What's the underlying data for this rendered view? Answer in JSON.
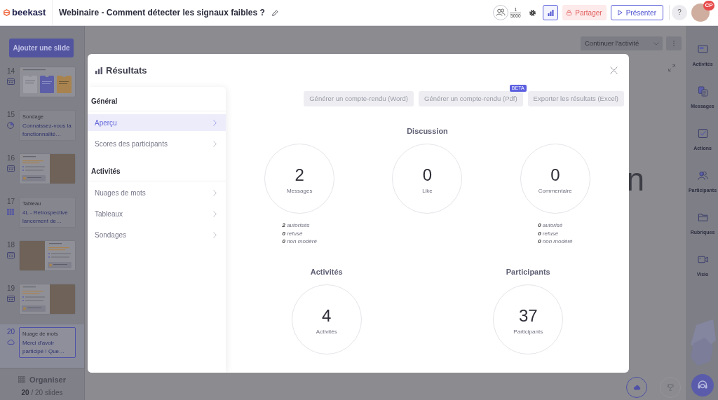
{
  "top_bar": {
    "logo": "beekast",
    "title": "Webinaire - Comment détecter les signaux faibles ?",
    "participants_current": "1",
    "participants_max": "5000",
    "results_button": {
      "selected": true
    },
    "share_button": "Partager",
    "present_button": "Présenter",
    "help_button": "?",
    "avatar_badge": "CP"
  },
  "slides_panel": {
    "add_button": "Ajouter une slide",
    "slides": [
      {
        "number": "14",
        "kind": "cards",
        "selected": false
      },
      {
        "number": "15",
        "kind": "poll",
        "type_label": "Sondage",
        "title": "Connaissez-vous la fonctionnalité…",
        "selected": false
      },
      {
        "number": "16",
        "kind": "text_photo",
        "selected": false
      },
      {
        "number": "17",
        "kind": "table",
        "type_label": "Tableau",
        "title": "4L - Retrospective lancement de…",
        "selected": false
      },
      {
        "number": "18",
        "kind": "photo_text",
        "selected": false
      },
      {
        "number": "19",
        "kind": "text_photo",
        "selected": false
      },
      {
        "number": "20",
        "kind": "word_cloud",
        "type_label": "Nuage de mots",
        "title": "Merci d'avoir participé ! Que…",
        "selected": true
      }
    ],
    "organize_button": "Organiser",
    "slide_count": "**20** / 20 slides"
  },
  "stage": {
    "continue_button": "Continuer l'activité",
    "slide_text": "n"
  },
  "right_sidebar": [
    {
      "kind": "activities",
      "label": "Activités"
    },
    {
      "kind": "messages",
      "label": "Messages"
    },
    {
      "kind": "actions",
      "label": "Actions"
    },
    {
      "kind": "participants",
      "label": "Participants"
    },
    {
      "kind": "rubrics",
      "label": "Rubriques"
    },
    {
      "kind": "video",
      "label": "Visio"
    }
  ],
  "results_modal": {
    "title": "Résultats",
    "nav": [
      {
        "heading": "Général",
        "items": [
          {
            "label": "Aperçu",
            "selected": true
          },
          {
            "label": "Scores des participants",
            "selected": false
          }
        ]
      },
      {
        "heading": "Activités",
        "items": [
          {
            "label": "Nuages de mots",
            "selected": false
          },
          {
            "label": "Tableaux",
            "selected": false
          },
          {
            "label": "Sondages",
            "selected": false
          }
        ]
      }
    ],
    "export_buttons": [
      {
        "label": "Générer un compte-rendu (Word)"
      },
      {
        "label": "Générer un compte-rendu (Pdf)",
        "badge": "BETA"
      },
      {
        "label": "Exporter les résultats (Excel)"
      }
    ],
    "rows": [
      {
        "sections": [
          {
            "title": "Discussion",
            "stats": [
              {
                "value": "2",
                "label": "Messages",
                "details": [
                  "**2** autorisés",
                  "**0** refusé",
                  "**0** non modéré"
                ]
              },
              {
                "value": "0",
                "label": "Like"
              },
              {
                "value": "0",
                "label": "Commentaire",
                "details": [
                  "**0** autorisé",
                  "**0** refusé",
                  "**0** non modéré"
                ]
              }
            ]
          }
        ]
      },
      {
        "sections": [
          {
            "title": "Activités",
            "stats": [
              {
                "value": "4",
                "label": "Activités"
              }
            ]
          },
          {
            "title": "Participants",
            "stats": [
              {
                "value": "37",
                "label": "Participants"
              }
            ]
          }
        ]
      }
    ]
  }
}
